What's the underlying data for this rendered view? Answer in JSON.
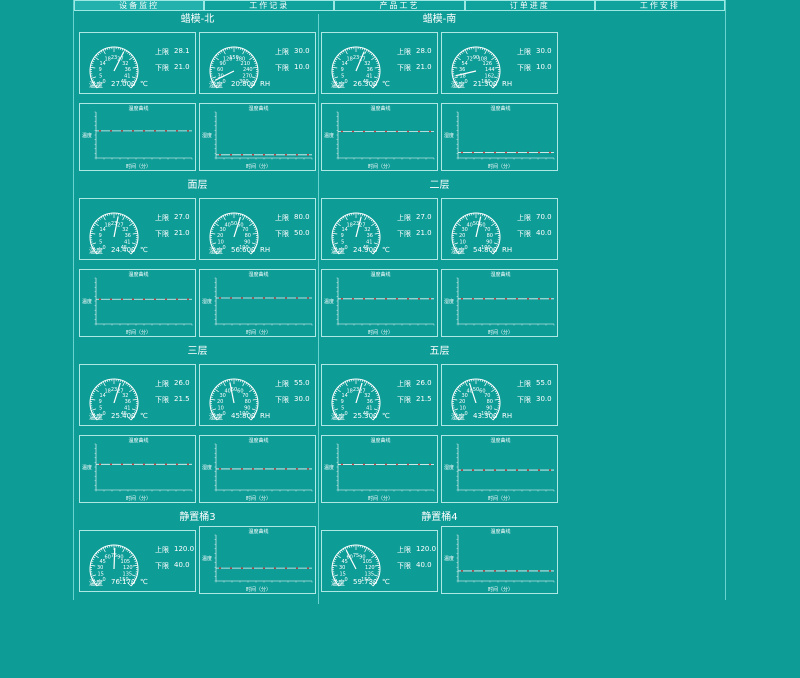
{
  "tabs": [
    {
      "label": "设备监控",
      "active": true
    },
    {
      "label": "工作记录",
      "active": false
    },
    {
      "label": "产品工艺",
      "active": false
    },
    {
      "label": "订单进度",
      "active": false
    },
    {
      "label": "工作安排",
      "active": false
    }
  ],
  "labels": {
    "temp": "温度",
    "hum": "湿度",
    "unit_c": "℃",
    "unit_rh": "RH",
    "upper": "上限",
    "lower": "下限",
    "temp_curve": "温度曲线",
    "hum_curve": "湿度曲线",
    "x_axis": "时间（分）",
    "y_axis_t": "温度",
    "y_axis_h": "湿度"
  },
  "sections": [
    {
      "title": "蜡模-北",
      "temp": {
        "value": "27.000",
        "upper": "28.1",
        "lower": "21.0",
        "ticks": [
          "0",
          "5",
          "9",
          "14",
          "18",
          "23",
          "27",
          "32",
          "36",
          "41",
          "45"
        ]
      },
      "hum": {
        "value": "20.800",
        "upper": "30.0",
        "lower": "10.0",
        "ticks": [
          "0",
          "30",
          "60",
          "90",
          "120",
          "150",
          "180",
          "210",
          "240",
          "270",
          "300"
        ]
      }
    },
    {
      "title": "蜡模-南",
      "temp": {
        "value": "26.300",
        "upper": "28.0",
        "lower": "21.0",
        "ticks": [
          "0",
          "5",
          "9",
          "14",
          "18",
          "23",
          "27",
          "32",
          "36",
          "41",
          "45"
        ]
      },
      "hum": {
        "value": "21.300",
        "upper": "30.0",
        "lower": "10.0",
        "ticks": [
          "0",
          "18",
          "36",
          "54",
          "72",
          "90",
          "108",
          "126",
          "144",
          "162",
          "180"
        ]
      }
    },
    {
      "title": "面层",
      "temp": {
        "value": "24.400",
        "upper": "27.0",
        "lower": "21.0",
        "ticks": [
          "0",
          "5",
          "9",
          "14",
          "18",
          "23",
          "27",
          "32",
          "36",
          "41",
          "45"
        ]
      },
      "hum": {
        "value": "56.600",
        "upper": "80.0",
        "lower": "50.0",
        "ticks": [
          "0",
          "10",
          "20",
          "30",
          "40",
          "50",
          "60",
          "70",
          "80",
          "90",
          "100"
        ]
      }
    },
    {
      "title": "二层",
      "temp": {
        "value": "24.900",
        "upper": "27.0",
        "lower": "21.0",
        "ticks": [
          "0",
          "5",
          "9",
          "14",
          "18",
          "23",
          "27",
          "32",
          "36",
          "41",
          "45"
        ]
      },
      "hum": {
        "value": "54.800",
        "upper": "70.0",
        "lower": "40.0",
        "ticks": [
          "0",
          "10",
          "20",
          "30",
          "40",
          "50",
          "60",
          "70",
          "80",
          "90",
          "100"
        ]
      }
    },
    {
      "title": "三层",
      "temp": {
        "value": "25.400",
        "upper": "26.0",
        "lower": "21.5",
        "ticks": [
          "0",
          "5",
          "9",
          "14",
          "18",
          "23",
          "27",
          "32",
          "36",
          "41",
          "45"
        ]
      },
      "hum": {
        "value": "45.800",
        "upper": "55.0",
        "lower": "30.0",
        "ticks": [
          "0",
          "10",
          "20",
          "30",
          "40",
          "50",
          "60",
          "70",
          "80",
          "90",
          "100"
        ]
      }
    },
    {
      "title": "五层",
      "temp": {
        "value": "25.300",
        "upper": "26.0",
        "lower": "21.5",
        "ticks": [
          "0",
          "5",
          "9",
          "14",
          "18",
          "23",
          "27",
          "32",
          "36",
          "41",
          "45"
        ]
      },
      "hum": {
        "value": "43.300",
        "upper": "55.0",
        "lower": "30.0",
        "ticks": [
          "0",
          "10",
          "20",
          "30",
          "40",
          "50",
          "60",
          "70",
          "80",
          "90",
          "100"
        ]
      }
    },
    {
      "title": "静置桶3",
      "temp": {
        "value": "76.170",
        "upper": "120.0",
        "lower": "40.0",
        "ticks": [
          "0",
          "15",
          "30",
          "45",
          "60",
          "75",
          "90",
          "105",
          "120",
          "135",
          "150"
        ]
      }
    },
    {
      "title": "静置桶4",
      "temp": {
        "value": "59.730",
        "upper": "120.0",
        "lower": "40.0",
        "ticks": [
          "0",
          "15",
          "30",
          "45",
          "60",
          "75",
          "90",
          "105",
          "120",
          "135",
          "150"
        ]
      }
    }
  ]
}
